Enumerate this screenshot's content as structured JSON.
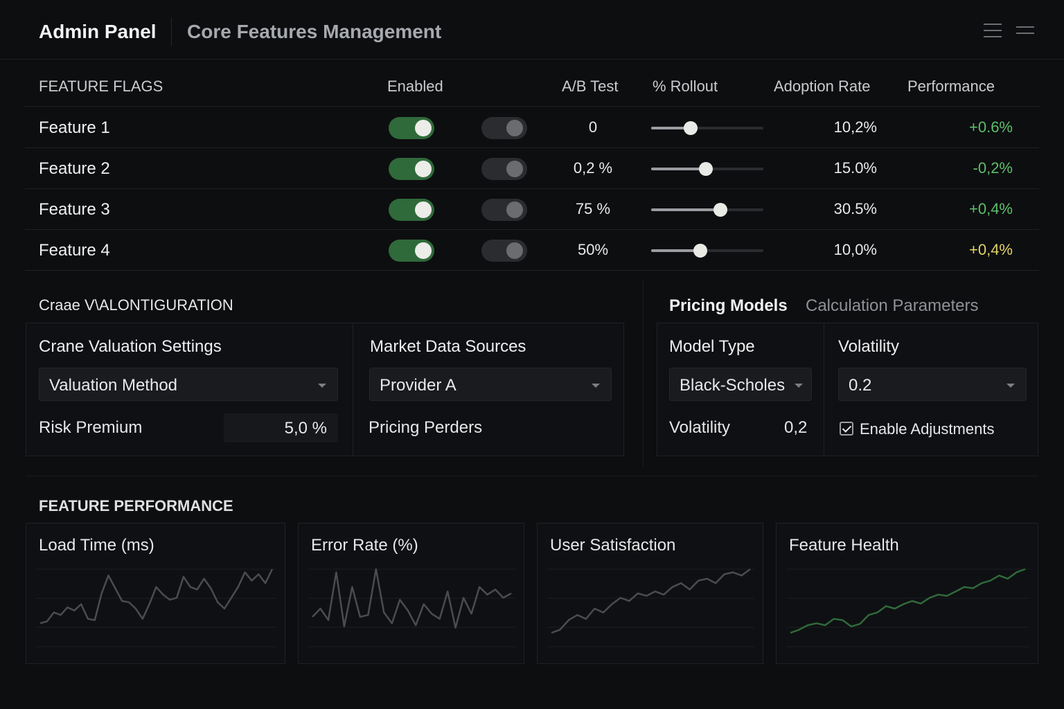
{
  "header": {
    "app_title": "Admin Panel",
    "page_title": "Core Features Management"
  },
  "flags": {
    "columns": {
      "feature": "FEATURE FLAGS",
      "enabled": "Enabled",
      "ab_test": "A/B Test",
      "rollout": "% Rollout",
      "adoption": "Adoption Rate",
      "performance": "Performance"
    },
    "rows": [
      {
        "name": "Feature 1",
        "enabled": true,
        "ab_test": false,
        "ab_value": "0",
        "rollout": 0.35,
        "adoption": "10,2%",
        "performance": "+0.6%",
        "perf_color": "#5fbf6a"
      },
      {
        "name": "Feature 2",
        "enabled": true,
        "ab_test": false,
        "ab_value": "0,2 %",
        "rollout": 0.49,
        "adoption": "15.0%",
        "performance": "-0,2%",
        "perf_color": "#5fbf6a"
      },
      {
        "name": "Feature 3",
        "enabled": true,
        "ab_test": false,
        "ab_value": "75 %",
        "rollout": 0.62,
        "adoption": "30.5%",
        "performance": "+0,4%",
        "perf_color": "#5fbf6a"
      },
      {
        "name": "Feature 4",
        "enabled": true,
        "ab_test": false,
        "ab_value": "50%",
        "rollout": 0.44,
        "adoption": "10,0%",
        "performance": "+0,4%",
        "perf_color": "#e3d36a"
      }
    ]
  },
  "config": {
    "section_title": "Craae V\\ALONTIGURATION",
    "crane": {
      "title": "Crane Valuation Settings",
      "method_select": "Valuation Method",
      "risk_label": "Risk Premium",
      "risk_value": "5,0 %"
    },
    "market": {
      "title": "Market Data Sources",
      "provider_select": "Provider A",
      "pricing_label": "Pricing Perders"
    }
  },
  "pricing": {
    "tab_active": "Pricing Models",
    "tab_inactive": "Calculation Parameters",
    "model_type_title": "Model Type",
    "model_select": "Black-Scholes",
    "volatility_label": "Volatility",
    "volatility_value": "0,2",
    "volatility_title": "Volatility",
    "volatility_select": "0.2",
    "adjustments_label": "Enable Adjustments",
    "adjustments_checked": true
  },
  "performance": {
    "section_title": "FEATURE PERFORMANCE",
    "cards": [
      {
        "title": "Load Time (ms)",
        "color": "#4a4c50",
        "values": [
          0.15,
          0.18,
          0.32,
          0.28,
          0.4,
          0.35,
          0.45,
          0.22,
          0.2,
          0.62,
          0.9,
          0.7,
          0.5,
          0.48,
          0.38,
          0.22,
          0.45,
          0.72,
          0.6,
          0.52,
          0.55,
          0.88,
          0.72,
          0.68,
          0.85,
          0.7,
          0.48,
          0.38,
          0.55,
          0.72,
          0.95,
          0.82,
          0.92,
          0.78,
          1.0
        ]
      },
      {
        "title": "Error Rate (%)",
        "color": "#4a4c50",
        "values": [
          0.25,
          0.38,
          0.2,
          0.95,
          0.1,
          0.72,
          0.25,
          0.28,
          1.0,
          0.32,
          0.15,
          0.52,
          0.35,
          0.12,
          0.45,
          0.3,
          0.22,
          0.65,
          0.08,
          0.55,
          0.3,
          0.72,
          0.6,
          0.68,
          0.55,
          0.62
        ]
      },
      {
        "title": "User Satisfaction",
        "color": "#4a4c50",
        "values": [
          0.0,
          0.05,
          0.2,
          0.28,
          0.22,
          0.38,
          0.32,
          0.45,
          0.55,
          0.5,
          0.62,
          0.58,
          0.65,
          0.6,
          0.72,
          0.78,
          0.68,
          0.82,
          0.85,
          0.78,
          0.92,
          0.95,
          0.9,
          1.0
        ]
      },
      {
        "title": "Feature Health",
        "color": "#2f6a3a",
        "values": [
          0.0,
          0.05,
          0.12,
          0.15,
          0.12,
          0.22,
          0.2,
          0.1,
          0.14,
          0.28,
          0.32,
          0.42,
          0.38,
          0.45,
          0.5,
          0.46,
          0.55,
          0.6,
          0.58,
          0.65,
          0.72,
          0.7,
          0.78,
          0.82,
          0.9,
          0.85,
          0.95,
          1.0
        ]
      }
    ]
  }
}
